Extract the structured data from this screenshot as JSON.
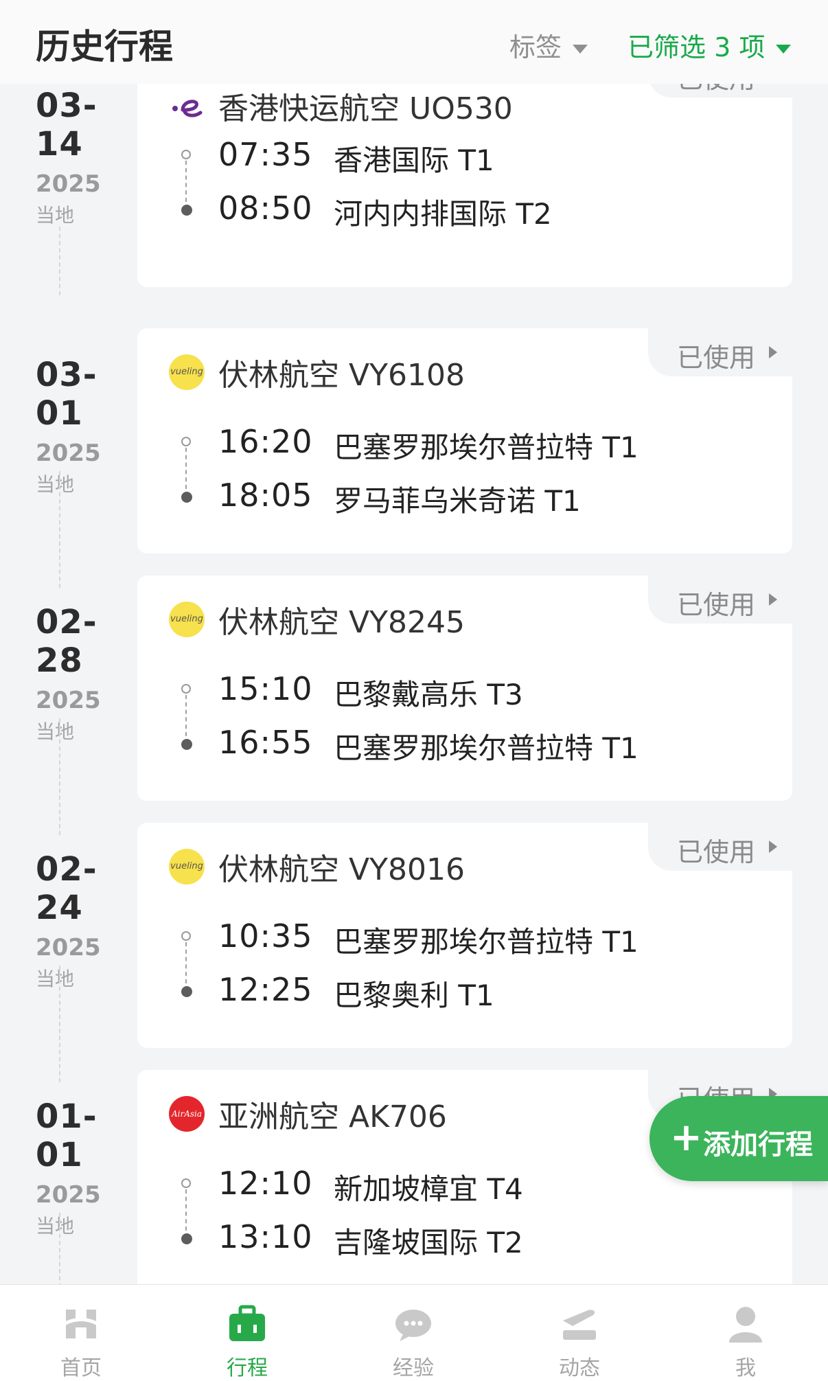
{
  "header": {
    "title": "历史行程",
    "filter_tags_label": "标签",
    "filter_selected_label": "已筛选 3 项"
  },
  "status_label": "已使用",
  "trips": [
    {
      "date": "03-14",
      "year": "2025",
      "local": "当地",
      "airline": "香港快运航空  UO530",
      "logo": "hk-express-logo",
      "dep_time": "07:35",
      "dep_airport": "香港国际 T1",
      "arr_time": "08:50",
      "arr_airport": "河内内排国际 T2"
    },
    {
      "date": "03-01",
      "year": "2025",
      "local": "当地",
      "airline": "伏林航空  VY6108",
      "logo": "vueling-logo",
      "logo_text": "vueling",
      "dep_time": "16:20",
      "dep_airport": "巴塞罗那埃尔普拉特 T1",
      "arr_time": "18:05",
      "arr_airport": "罗马菲乌米奇诺 T1"
    },
    {
      "date": "02-28",
      "year": "2025",
      "local": "当地",
      "airline": "伏林航空  VY8245",
      "logo": "vueling-logo",
      "logo_text": "vueling",
      "dep_time": "15:10",
      "dep_airport": "巴黎戴高乐 T3",
      "arr_time": "16:55",
      "arr_airport": "巴塞罗那埃尔普拉特 T1"
    },
    {
      "date": "02-24",
      "year": "2025",
      "local": "当地",
      "airline": "伏林航空  VY8016",
      "logo": "vueling-logo",
      "logo_text": "vueling",
      "dep_time": "10:35",
      "dep_airport": "巴塞罗那埃尔普拉特 T1",
      "arr_time": "12:25",
      "arr_airport": "巴黎奥利 T1"
    },
    {
      "date": "01-01",
      "year": "2025",
      "local": "当地",
      "airline": "亚洲航空  AK706",
      "logo": "airasia-logo",
      "logo_text": "AirAsia",
      "dep_time": "12:10",
      "dep_airport": "新加坡樟宜 T4",
      "arr_time": "13:10",
      "arr_airport": "吉隆坡国际 T2"
    }
  ],
  "add_button": {
    "plus": "+",
    "label": "添加行程"
  },
  "nav": [
    {
      "label": "首页",
      "icon": "home-icon",
      "active": false
    },
    {
      "label": "行程",
      "icon": "luggage-icon",
      "active": true
    },
    {
      "label": "经验",
      "icon": "chat-icon",
      "active": false
    },
    {
      "label": "动态",
      "icon": "flight-status-icon",
      "active": false
    },
    {
      "label": "我",
      "icon": "profile-icon",
      "active": false
    }
  ],
  "colors": {
    "accent_green": "#19a94a",
    "button_green": "#3bb45b",
    "vueling_yellow": "#f7e14c",
    "airasia_red": "#e3262b",
    "hk_express_purple": "#6b2c8f"
  }
}
